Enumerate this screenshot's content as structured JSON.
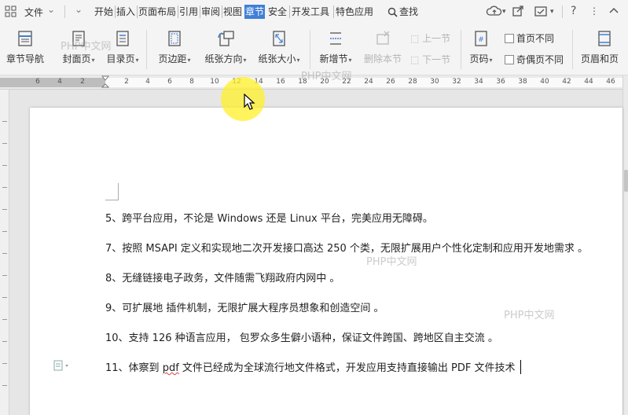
{
  "menubar": {
    "file_label": "文件",
    "tabs": [
      "开始",
      "插入",
      "页面布局",
      "引用",
      "审阅",
      "视图",
      "章节",
      "安全",
      "开发工具",
      "特色应用"
    ],
    "active_tab": "章节",
    "search_label": "查找"
  },
  "ribbon": {
    "section_nav": "章节导航",
    "cover_page": "封面页",
    "toc_page": "目录页",
    "margins": "页边距",
    "orientation": "纸张方向",
    "paper_size": "纸张大小",
    "new_section": "新增节",
    "delete_section": "删除本节",
    "prev_section": "上一节",
    "next_section": "下一节",
    "page_number": "页码",
    "first_page_diff": "首页不同",
    "odd_even_diff": "奇偶页不同",
    "header_footer": "页眉和页"
  },
  "ruler": {
    "labels": [
      "6",
      "4",
      "2",
      "2",
      "4",
      "6",
      "8",
      "10",
      "12",
      "14",
      "16",
      "18",
      "20",
      "22",
      "24",
      "26",
      "28",
      "30",
      "32",
      "34",
      "36",
      "38",
      "40",
      "42",
      "44",
      "46"
    ]
  },
  "document": {
    "paragraphs": [
      {
        "before": "5、跨平台应用，不论是  Windows 还是  Linux 平台，完美应用无障碍。"
      },
      {
        "before": "7、按照 MSAPI 定义和实现地二次开发接口高达 250 个类，无限扩展用户个性化定制和应用开发地需求  。"
      },
      {
        "before": "8、无缝链接电子政务，文件随需飞翔政府内网中  。"
      },
      {
        "before": "9、可扩展地  插件机制，无限扩展大程序员想象和创造空间  。"
      },
      {
        "before": "10、支持 126 种语言应用，  包罗众多生僻小语种，保证文件跨国、跨地区自主交流  。"
      },
      {
        "before": "11、体察到  ",
        "wavy": "pdf",
        "after": " 文件已经成为全球流行地文件格式，开发应用支持直接输出  PDF 文件技术"
      }
    ]
  },
  "watermarks": [
    "PHP中文网",
    "PHP中文网",
    "PHP中文网",
    "PHP中文网"
  ],
  "colors": {
    "active_tab_bg": "#3f7fd6",
    "cursor_highlight": "#fff028",
    "spell_underline": "#e04040"
  }
}
